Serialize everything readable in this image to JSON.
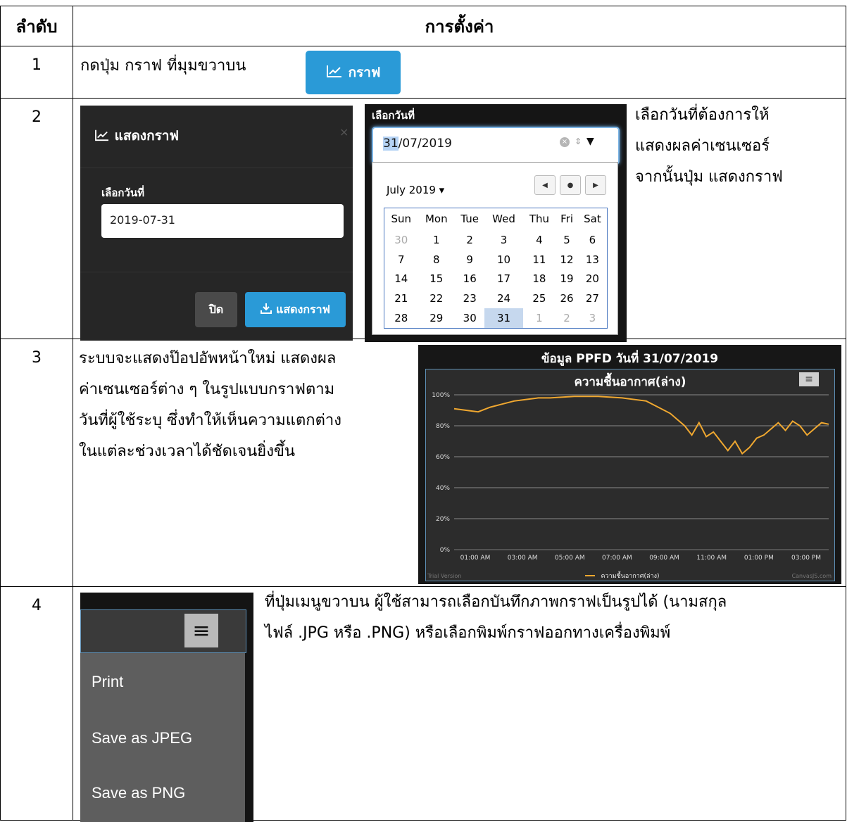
{
  "header": {
    "col_order": "ลำดับ",
    "col_setting": "การตั้งค่า"
  },
  "rows": [
    {
      "num": "1",
      "text": "กดปุ่ม กราฟ ที่มุมขวาบน",
      "button_label": "กราฟ"
    },
    {
      "num": "2",
      "modal": {
        "title": "แสดงกราฟ",
        "close_glyph": "×",
        "date_label": "เลือกวันที่",
        "date_value": "2019-07-31",
        "close_button": "ปิด",
        "show_button": "แสดงกราฟ"
      },
      "datepicker": {
        "label": "เลือกวันที่",
        "value_day": "31",
        "value_rest": "/07/2019",
        "month": "July 2019 ▾",
        "weekdays": [
          "Sun",
          "Mon",
          "Tue",
          "Wed",
          "Thu",
          "Fri",
          "Sat"
        ],
        "weeks": [
          [
            "30",
            "1",
            "2",
            "3",
            "4",
            "5",
            "6"
          ],
          [
            "7",
            "8",
            "9",
            "10",
            "11",
            "12",
            "13"
          ],
          [
            "14",
            "15",
            "16",
            "17",
            "18",
            "19",
            "20"
          ],
          [
            "21",
            "22",
            "23",
            "24",
            "25",
            "26",
            "27"
          ],
          [
            "28",
            "29",
            "30",
            "31",
            "1",
            "2",
            "3"
          ]
        ]
      },
      "text_lines": [
        "เลือกวันที่ต้องการให้",
        "แสดงผลค่าเซนเซอร์",
        "จากนั้นปุ่ม แสดงกราฟ"
      ]
    },
    {
      "num": "3",
      "text_lines": [
        "ระบบจะแสดงป๊อปอัพหน้าใหม่ แสดงผล",
        "ค่าเซนเซอร์ต่าง ๆ ในรูปแบบกราฟตาม",
        "วันที่ผู้ใช้ระบุ ซึ่งทำให้เห็นความแตกต่าง",
        "ในแต่ละช่วงเวลาได้ชัดเจนยิ่งขึ้น"
      ]
    },
    {
      "num": "4",
      "menu": {
        "items": [
          "Print",
          "Save as JPEG",
          "Save as PNG"
        ]
      },
      "text_lines": [
        "ที่ปุ่มเมนูขวาบน ผู้ใช้สามารถเลือกบันทึกภาพกราฟเป็นรูปได้ (นามสกุล",
        "ไฟล์ .JPG หรือ .PNG) หรือเลือกพิมพ์กราฟออกทางเครื่องพิมพ์"
      ]
    }
  ],
  "chart_data": {
    "type": "line",
    "heading": "ข้อมูล PPFD วันที่ 31/07/2019",
    "title": "ความชื้นอากาศ(ล่าง)",
    "y_ticks": [
      "0%",
      "20%",
      "40%",
      "60%",
      "80%",
      "100%"
    ],
    "ylim": [
      0,
      100
    ],
    "x_ticks": [
      "01:00 AM",
      "03:00 AM",
      "05:00 AM",
      "07:00 AM",
      "09:00 AM",
      "11:00 AM",
      "01:00 PM",
      "03:00 PM"
    ],
    "legend": "ความชื้นอากาศ(ล่าง)",
    "footer_left": "Trial Version",
    "footer_right": "CanvasJS.com",
    "line_color": "#f0a830",
    "series": [
      {
        "name": "ความชื้นอากาศ(ล่าง)",
        "x": [
          0.0,
          0.5,
          1.0,
          1.5,
          2.0,
          2.5,
          3.0,
          3.5,
          4.0,
          5.0,
          6.0,
          7.0,
          8.0,
          8.5,
          9.0,
          9.3,
          9.6,
          9.9,
          10.2,
          10.5,
          10.8,
          11.1,
          11.4,
          11.7,
          12.0,
          12.3,
          12.6,
          12.9,
          13.2,
          13.5,
          13.8,
          14.1,
          14.4,
          14.7,
          15.0,
          15.3,
          15.6
        ],
        "values": [
          91,
          90,
          89,
          92,
          94,
          96,
          97,
          98,
          98,
          99,
          99,
          98,
          96,
          92,
          88,
          84,
          80,
          74,
          82,
          73,
          76,
          70,
          64,
          70,
          62,
          66,
          72,
          74,
          78,
          82,
          77,
          83,
          80,
          74,
          78,
          82,
          81
        ]
      }
    ]
  }
}
